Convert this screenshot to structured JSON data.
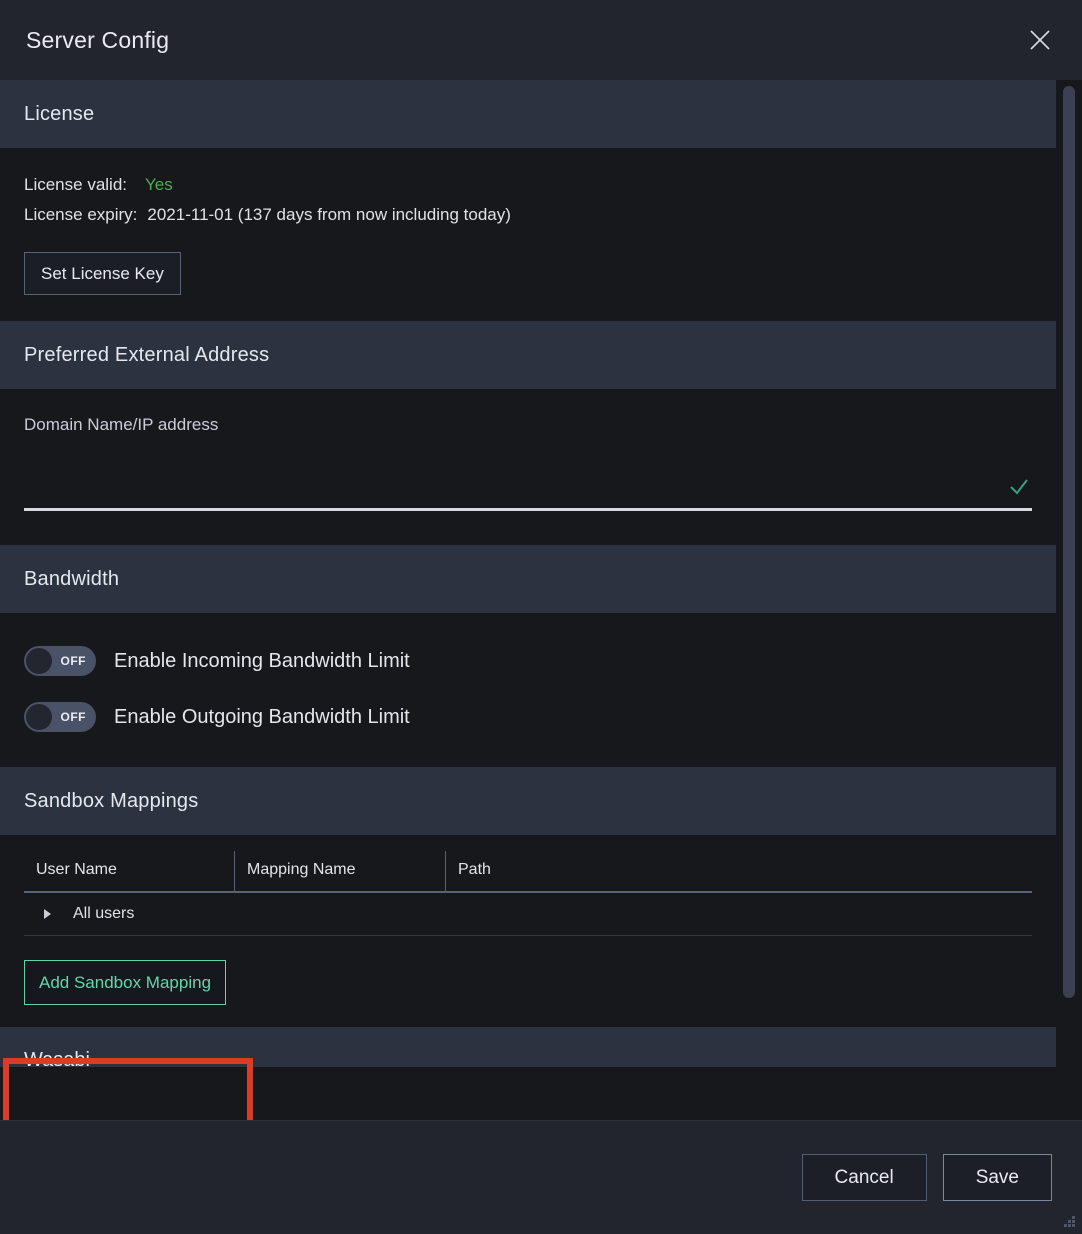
{
  "window": {
    "title": "Server Config",
    "close_icon": "close-icon"
  },
  "sections": {
    "license": {
      "header": "License",
      "valid_label": "License valid:",
      "valid_value": "Yes",
      "expiry_label": "License expiry:",
      "expiry_value": "2021-11-01 (137 days from now including today)",
      "set_key_button": "Set License Key"
    },
    "preferred_external_address": {
      "header": "Preferred External Address",
      "field_label": "Domain Name/IP address",
      "field_value": "",
      "field_placeholder": "",
      "valid_icon": "checkmark-icon"
    },
    "bandwidth": {
      "header": "Bandwidth",
      "toggles": [
        {
          "label": "Enable Incoming Bandwidth Limit",
          "state": "OFF"
        },
        {
          "label": "Enable Outgoing Bandwidth Limit",
          "state": "OFF"
        }
      ]
    },
    "sandbox_mappings": {
      "header": "Sandbox Mappings",
      "columns": [
        "User Name",
        "Mapping Name",
        "Path"
      ],
      "rows": [
        {
          "user_name": "All users",
          "mapping_name": "",
          "path": "",
          "expander": "collapsed"
        }
      ],
      "add_button": "Add Sandbox Mapping"
    },
    "clipped_next": {
      "header": "Wasabi"
    }
  },
  "footer": {
    "cancel_label": "Cancel",
    "save_label": "Save"
  },
  "colors": {
    "accent_green": "#63d6ac",
    "valid_green": "#4caf50",
    "highlight_red": "#d93d28",
    "section_header_bg": "#2b3240",
    "content_bg": "#16181c",
    "chrome_bg": "#22252e"
  }
}
